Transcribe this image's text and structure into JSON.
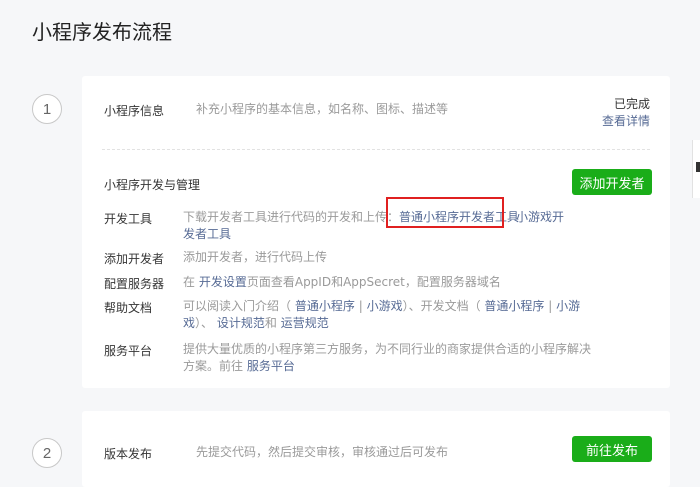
{
  "page": {
    "title": "小程序发布流程"
  },
  "step1": {
    "number": "1",
    "info_label": "小程序信息",
    "info_desc": "补充小程序的基本信息，如名称、图标、描述等",
    "status": "已完成",
    "details_link": "查看详情",
    "dev_section_title": "小程序开发与管理",
    "add_dev_button": "添加开发者",
    "rows": {
      "dev_tools": {
        "label": "开发工具",
        "text1": "下载开发者工具进行代码的开发和上传：",
        "link1": "普通小程序开发者工具",
        "link2a": "小游戏开",
        "link2b": "发者工具"
      },
      "add_dev": {
        "label": "添加开发者",
        "text": "添加开发者，进行代码上传"
      },
      "config": {
        "label": "配置服务器",
        "text1": "在",
        "link": "开发设置",
        "text2": "页面查看AppID和AppSecret，配置服务器域名"
      },
      "help": {
        "label": "帮助文档",
        "text1": "可以阅读入门介绍（",
        "link1": "普通小程序",
        "link2": "小游戏",
        "text2": "）、开发文档（",
        "link3": "普通小程序",
        "link4a": "小游",
        "link4b": "戏",
        "text3": "）、",
        "link5": "设计规范",
        "text4": "和",
        "link6": "运营规范",
        "sep": "|"
      },
      "service": {
        "label": "服务平台",
        "text1": "提供大量优质的小程序第三方服务，为不同行业的商家提供合适的小程序解决",
        "text2": "方案。前往",
        "link": "服务平台"
      }
    }
  },
  "step2": {
    "number": "2",
    "label": "版本发布",
    "desc": "先提交代码，然后提交审核，审核通过后可发布",
    "button": "前往发布"
  },
  "colors": {
    "primary_button": "#1aad19",
    "link": "#576b95",
    "highlight_box": "#e02020"
  }
}
